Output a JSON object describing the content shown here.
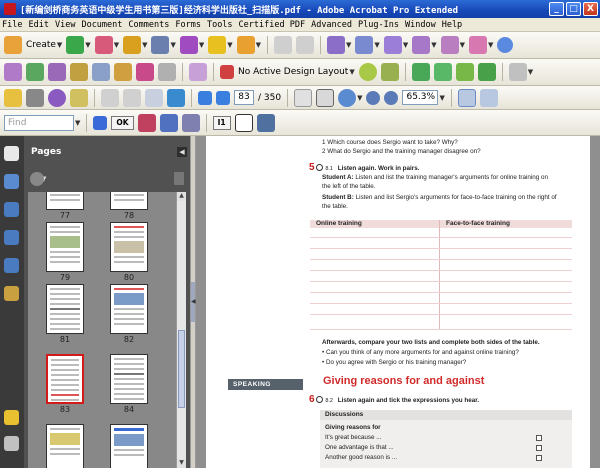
{
  "window": {
    "title": "[新编剑桥商务英语中级学生用书第三版]经济科学出版社_扫描版.pdf - Adobe Acrobat Pro Extended",
    "controls": {
      "minimize": "_",
      "maximize": "□",
      "close": "X"
    }
  },
  "menu": [
    "File",
    "Edit",
    "View",
    "Document",
    "Comments",
    "Forms",
    "Tools",
    "Certified PDF",
    "Advanced",
    "Plug-Ins",
    "Window",
    "Help"
  ],
  "toolbar": {
    "create_label": "Create",
    "design_layout_label": "No Active Design Layout",
    "current_page": "83",
    "total_pages": "/ 350",
    "zoom": "65.3%",
    "find_placeholder": "Find",
    "ok_label": "OK",
    "i1_label": "I1",
    "icon_colors": {
      "accent_blue": "#3a6fd8",
      "accent_green": "#3aa84a",
      "accent_red": "#c4161c"
    }
  },
  "pages_panel": {
    "title": "Pages",
    "thumbnails": [
      {
        "label": "77",
        "selected": false
      },
      {
        "label": "78",
        "selected": false
      },
      {
        "label": "79",
        "selected": false
      },
      {
        "label": "80",
        "selected": false
      },
      {
        "label": "81",
        "selected": false
      },
      {
        "label": "82",
        "selected": false
      },
      {
        "label": "83",
        "selected": true
      },
      {
        "label": "84",
        "selected": false
      }
    ]
  },
  "document": {
    "q1": "1  Which course does Sergio want to take? Why?",
    "q2": "2  What do Sergio and the training manager disagree on?",
    "ex5_num": "5",
    "ex5_track": "8.1",
    "ex5_title": "Listen again. Work in pairs.",
    "studentA_b": "Student A:",
    "studentA_t": " Listen and list the training manager's arguments for online training on",
    "studentA_t2": "the left of the table.",
    "studentB_b": "Student B:",
    "studentB_t": " Listen and list Sergio's arguments for face-to-face training on the right of",
    "studentB_t2": "the table.",
    "col_online": "Online training",
    "col_f2f": "Face-to-face training",
    "afterwards": "Afterwards, compare your two lists and complete both sides of the table.",
    "bullet1": "•  Can you think of any more arguments for and against online training?",
    "bullet2": "•  Do you agree with Sergio or his training manager?",
    "speaking_tag": "SPEAKING",
    "section_title": "Giving reasons for and against",
    "ex6_num": "6",
    "ex6_track": "8.2",
    "ex6_title": "Listen again and tick the expressions you hear.",
    "disc_header": "Discussions",
    "disc_sub": "Giving reasons for",
    "disc1": "It's great because ...",
    "disc2": "One advantage is that ...",
    "disc3": "Another good reason is ..."
  }
}
